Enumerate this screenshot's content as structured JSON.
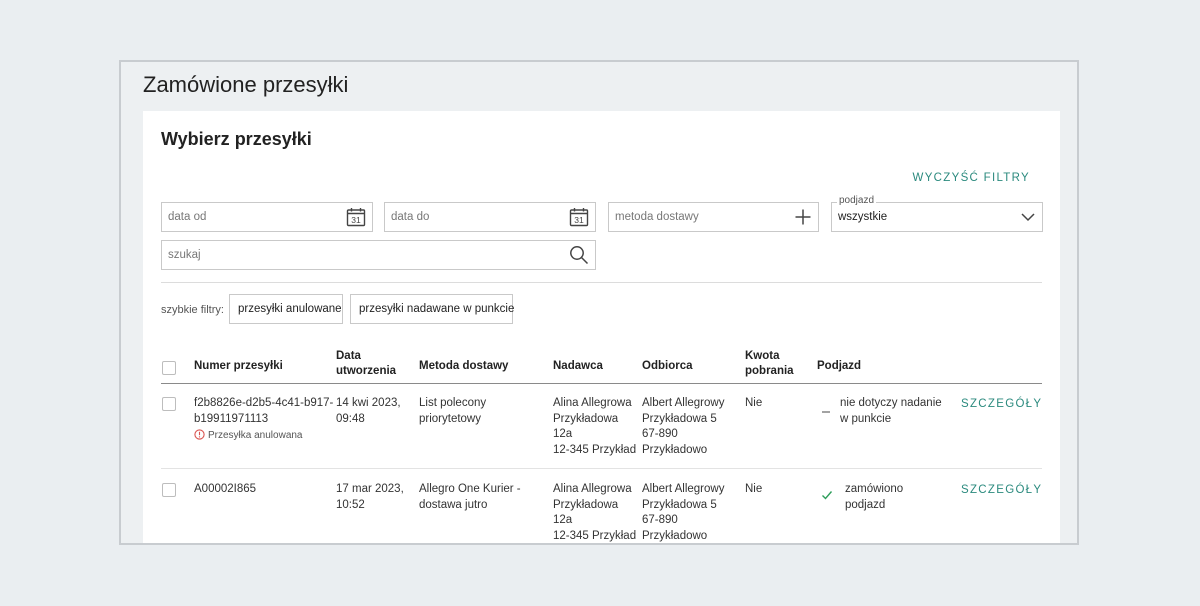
{
  "page": {
    "title": "Zamówione przesyłki"
  },
  "card": {
    "title": "Wybierz przesyłki",
    "clear_filters": "WYCZYŚĆ FILTRY"
  },
  "filters": {
    "date_from": {
      "placeholder": "data od"
    },
    "date_to": {
      "placeholder": "data do"
    },
    "delivery_method": {
      "placeholder": "metoda dostawy"
    },
    "pickup": {
      "legend": "podjazd",
      "value": "wszystkie"
    },
    "search": {
      "placeholder": "szukaj"
    },
    "calendar_icon_text": "31"
  },
  "quick_filters": {
    "label": "szybkie filtry:",
    "items": [
      "przesyłki anulowane",
      "przesyłki nadawane w punkcie"
    ]
  },
  "table": {
    "headers": {
      "number": "Numer przesyłki",
      "date_line1": "Data",
      "date_line2": "utworzenia",
      "method": "Metoda dostawy",
      "sender": "Nadawca",
      "recipient": "Odbiorca",
      "cod_line1": "Kwota",
      "cod_line2": "pobrania",
      "pickup": "Podjazd"
    },
    "rows": [
      {
        "number_line1": "f2b8826e-d2b5-4c41-b917-",
        "number_line2": "b19911971113",
        "warning": "Przesyłka anulowana",
        "date_line1": "14 kwi 2023,",
        "date_line2": "09:48",
        "method_line1": "List polecony",
        "method_line2": "priorytetowy",
        "sender": [
          "Alina Allegrowa",
          "Przykładowa",
          "12a",
          "12-345 Przykład"
        ],
        "recipient": [
          "Albert Allegrowy",
          "Przykładowa 5",
          "67-890",
          "Przykładowo"
        ],
        "cod": "Nie",
        "pickup_icon": "dash-icon",
        "pickup_line1": "nie dotyczy nadanie",
        "pickup_line2": "w punkcie",
        "details": "SZCZEGÓŁY"
      },
      {
        "number_line1": "A00002I865",
        "date_line1": "17 mar 2023,",
        "date_line2": "10:52",
        "method_line1": "Allegro One Kurier -",
        "method_line2": "dostawa jutro",
        "sender": [
          "Alina Allegrowa",
          "Przykładowa",
          "12a",
          "12-345 Przykład"
        ],
        "recipient": [
          "Albert Allegrowy",
          "Przykładowa 5",
          "67-890",
          "Przykładowo"
        ],
        "cod": "Nie",
        "pickup_icon": "check-icon",
        "pickup_line1": "zamówiono",
        "pickup_line2": "podjazd",
        "details": "SZCZEGÓŁY"
      }
    ]
  },
  "colors": {
    "accent": "#2b8a7e",
    "warning": "#d9534f",
    "check": "#2e9e5b",
    "background": "#eaeef1"
  }
}
